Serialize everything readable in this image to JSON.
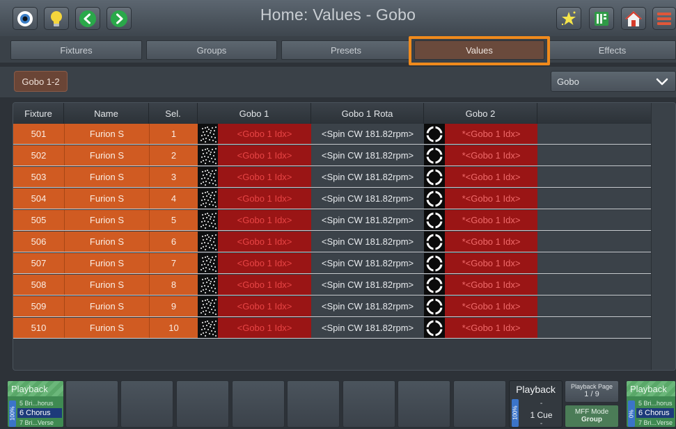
{
  "header": {
    "title": "Home: Values - Gobo"
  },
  "tabs": [
    {
      "label": "Fixtures"
    },
    {
      "label": "Groups"
    },
    {
      "label": "Presets"
    },
    {
      "label": "Values"
    },
    {
      "label": "Effects"
    }
  ],
  "toolbar": {
    "group_button": "Gobo 1-2",
    "dropdown_value": "Gobo"
  },
  "table": {
    "columns": [
      "Fixture",
      "Name",
      "Sel.",
      "Gobo 1",
      "Gobo 1 Rota",
      "Gobo 2"
    ],
    "rows": [
      {
        "fixture": "501",
        "name": "Furion S",
        "sel": "1",
        "gobo1": "<Gobo 1 Idx>",
        "rota": "<Spin CW 181.82rpm>",
        "gobo2": "*<Gobo 1 Idx>"
      },
      {
        "fixture": "502",
        "name": "Furion S",
        "sel": "2",
        "gobo1": "<Gobo 1 Idx>",
        "rota": "<Spin CW 181.82rpm>",
        "gobo2": "*<Gobo 1 Idx>"
      },
      {
        "fixture": "503",
        "name": "Furion S",
        "sel": "3",
        "gobo1": "<Gobo 1 Idx>",
        "rota": "<Spin CW 181.82rpm>",
        "gobo2": "*<Gobo 1 Idx>"
      },
      {
        "fixture": "504",
        "name": "Furion S",
        "sel": "4",
        "gobo1": "<Gobo 1 Idx>",
        "rota": "<Spin CW 181.82rpm>",
        "gobo2": "*<Gobo 1 Idx>"
      },
      {
        "fixture": "505",
        "name": "Furion S",
        "sel": "5",
        "gobo1": "<Gobo 1 Idx>",
        "rota": "<Spin CW 181.82rpm>",
        "gobo2": "*<Gobo 1 Idx>"
      },
      {
        "fixture": "506",
        "name": "Furion S",
        "sel": "6",
        "gobo1": "<Gobo 1 Idx>",
        "rota": "<Spin CW 181.82rpm>",
        "gobo2": "*<Gobo 1 Idx>"
      },
      {
        "fixture": "507",
        "name": "Furion S",
        "sel": "7",
        "gobo1": "<Gobo 1 Idx>",
        "rota": "<Spin CW 181.82rpm>",
        "gobo2": "*<Gobo 1 Idx>"
      },
      {
        "fixture": "508",
        "name": "Furion S",
        "sel": "8",
        "gobo1": "<Gobo 1 Idx>",
        "rota": "<Spin CW 181.82rpm>",
        "gobo2": "*<Gobo 1 Idx>"
      },
      {
        "fixture": "509",
        "name": "Furion S",
        "sel": "9",
        "gobo1": "<Gobo 1 Idx>",
        "rota": "<Spin CW 181.82rpm>",
        "gobo2": "*<Gobo 1 Idx>"
      },
      {
        "fixture": "510",
        "name": "Furion S",
        "sel": "10",
        "gobo1": "<Gobo 1 Idx>",
        "rota": "<Spin CW 181.82rpm>",
        "gobo2": "*<Gobo 1 Idx>"
      }
    ]
  },
  "playback_left": {
    "title": "Playback",
    "level": "100%",
    "prev_cue": "5 Bri...horus",
    "current_cue": "6 Chorus",
    "next_cue": "7 Bri...Verse"
  },
  "playback_mid": {
    "title": "Playback",
    "level": "100%",
    "line_top": "-",
    "cue": "1 Cue",
    "line_bottom": "-"
  },
  "playback_page": {
    "label": "Playback Page",
    "value": "1 / 9"
  },
  "mff": {
    "label": "MFF Mode",
    "value": "Group"
  },
  "playback_right": {
    "title": "Playback",
    "level": "0%",
    "prev_cue": "5 Bri...horus",
    "current_cue": "6 Chorus",
    "next_cue": "7 Bri...Verse"
  },
  "icons": [
    "eye-icon",
    "bulb-icon",
    "back-icon",
    "forward-icon",
    "magic-icon",
    "sheet-icon",
    "home-icon",
    "menu-icon"
  ],
  "colors": {
    "accent": "#f08a1c",
    "selected": "#d05b22",
    "gobo_value": "#9a1515",
    "playback": "#3f8a52"
  }
}
